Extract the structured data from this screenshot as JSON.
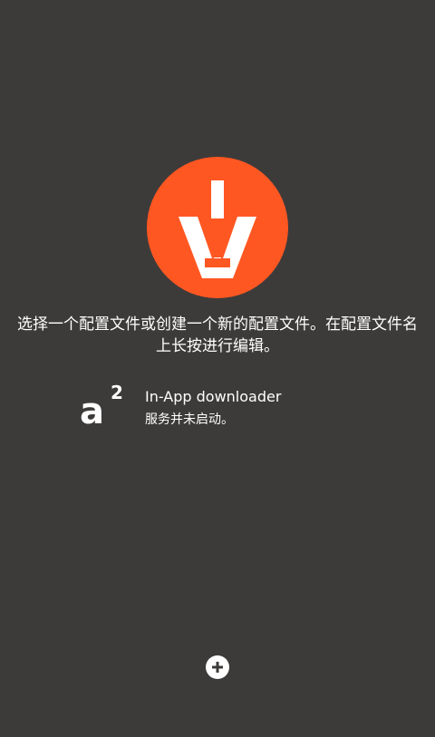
{
  "colors": {
    "background": "#3d3b3a",
    "logo_accent": "#ff5722",
    "text": "#ffffff"
  },
  "logo": {
    "icon": "download-arrow-logo-icon"
  },
  "main": {
    "instruction": "选择一个配置文件或创建一个新的配置文件。在配置文件名上长按进行编辑。"
  },
  "profiles": [
    {
      "icon": "a-squared-icon",
      "icon_letter": "a",
      "icon_superscript": "2",
      "name": "In-App downloader",
      "status": "服务并未启动。"
    }
  ],
  "actions": {
    "add_icon": "plus-icon"
  }
}
